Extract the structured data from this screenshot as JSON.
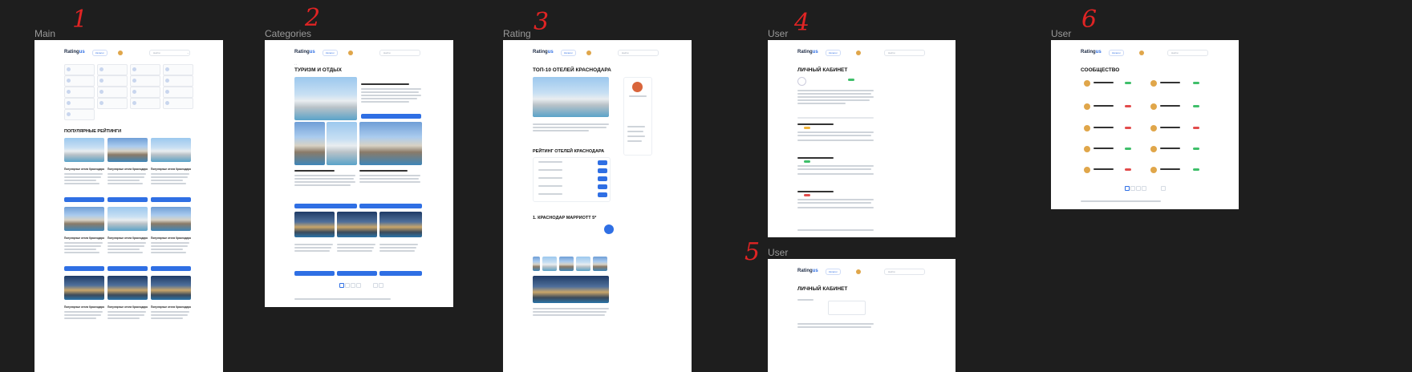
{
  "frames": [
    {
      "label": "Main",
      "number": "1"
    },
    {
      "label": "Categories",
      "number": "2"
    },
    {
      "label": "Rating",
      "number": "3"
    },
    {
      "label": "User",
      "number": "4"
    },
    {
      "label": "User",
      "number": "5"
    },
    {
      "label": "User",
      "number": "6"
    }
  ],
  "brand": {
    "name": "Rating",
    "suffix": "us"
  },
  "header": {
    "catalog_button": "Каталог",
    "search_placeholder": "Найти"
  },
  "main": {
    "section_title": "ПОПУЛЯРНЫЕ РЕЙТИНГИ",
    "card_title": "Популярные отели Краснодара"
  },
  "categories": {
    "title": "ТУРИЗМ И ОТДЫХ"
  },
  "rating": {
    "title": "ТОП-10 ОТЕЛЕЙ КРАСНОДАРА",
    "section_title": "РЕЙТИНГ ОТЕЛЕЙ КРАСНОДАРА",
    "item_title": "1. КРАСНОДАР МАРРИОТТ 5*"
  },
  "user4": {
    "title": "ЛИЧНЫЙ КАБИНЕТ"
  },
  "user5": {
    "title": "ЛИЧНЫЙ КАБИНЕТ"
  },
  "user6": {
    "title": "СООБЩЕСТВО"
  },
  "colors": {
    "accent": "#2f6fe4",
    "canvas": "#1e1e1e",
    "marker": "#e02424"
  }
}
